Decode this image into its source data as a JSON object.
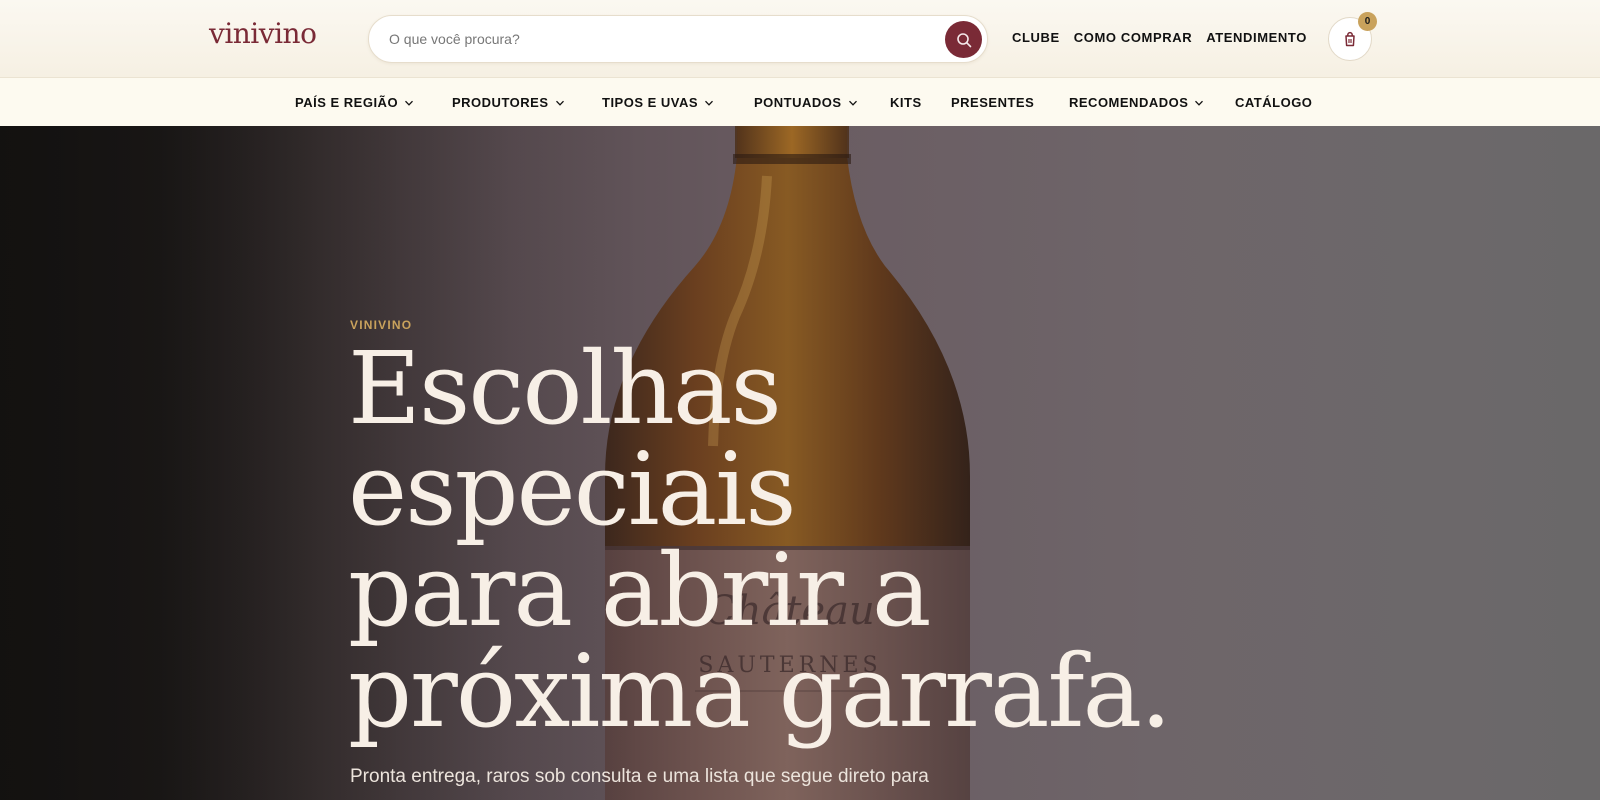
{
  "header": {
    "logo": "vinivino",
    "search": {
      "placeholder": "O que você procura?",
      "value": ""
    },
    "links": [
      "CLUBE",
      "COMO COMPRAR",
      "ATENDIMENTO"
    ],
    "cart_count": "0"
  },
  "nav": {
    "items": [
      {
        "label": "PAÍS E REGIÃO",
        "dropdown": true
      },
      {
        "label": "PRODUTORES",
        "dropdown": true
      },
      {
        "label": "TIPOS E UVAS",
        "dropdown": true
      },
      {
        "label": "PONTUADOS",
        "dropdown": true
      },
      {
        "label": "KITS",
        "dropdown": false
      },
      {
        "label": "PRESENTES",
        "dropdown": false
      },
      {
        "label": "RECOMENDADOS",
        "dropdown": true
      },
      {
        "label": "CATÁLOGO",
        "dropdown": false
      }
    ]
  },
  "hero": {
    "eyebrow": "VINIVINO",
    "headline_lines": [
      "Escolhas",
      "especiais",
      "para abrir a",
      "próxima garrafa."
    ],
    "subtext": "Pronta entrega, raros sob consulta e uma lista que segue direto para"
  },
  "colors": {
    "brand": "#7a2a36",
    "accent_gold": "#c9a25c",
    "header_bg": "#fbf8f1",
    "nav_bg": "#fdfaf0"
  },
  "icons": {
    "search": "search-icon",
    "cart": "shopping-bag-icon",
    "chevron": "chevron-down-icon"
  }
}
